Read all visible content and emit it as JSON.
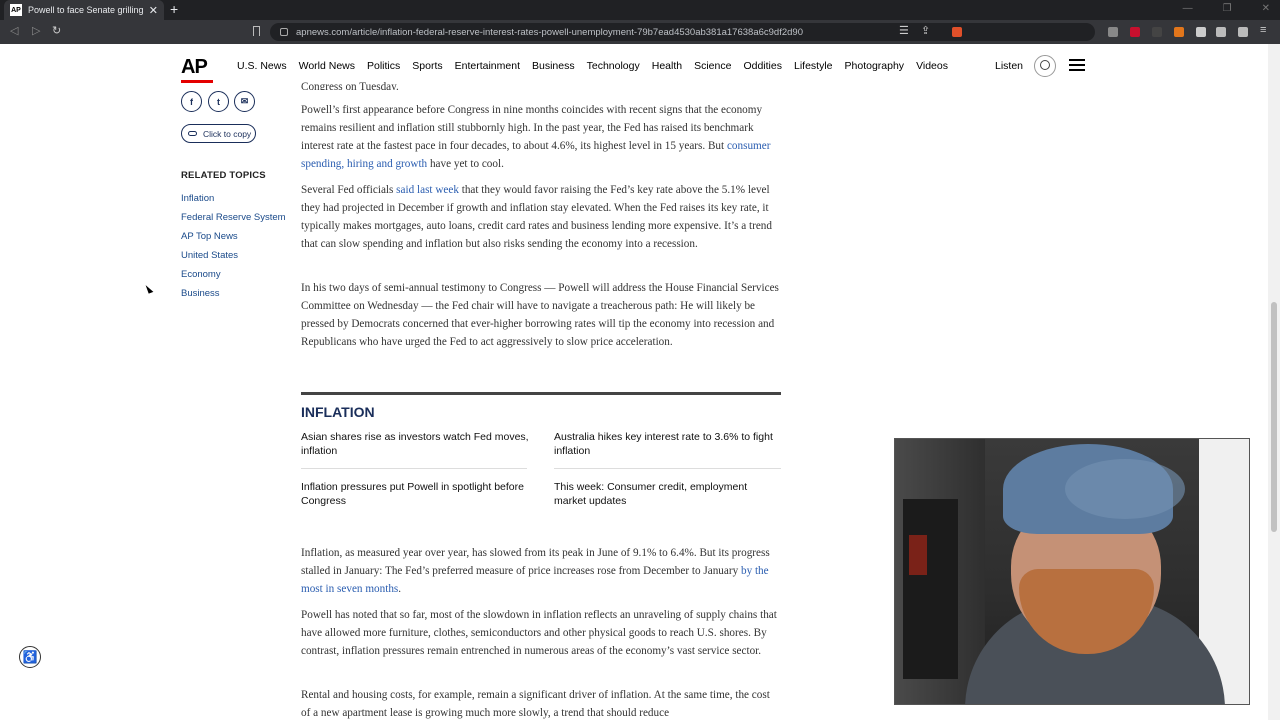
{
  "browser": {
    "tab_favicon": "AP",
    "tab_title": "Powell to face Senate grilling on",
    "url": "apnews.com/article/inflation-federal-reserve-interest-rates-powell-unemployment-79b7ead4530ab381a17638a6c9df2d90"
  },
  "site": {
    "logo": "AP",
    "nav": [
      "U.S. News",
      "World News",
      "Politics",
      "Sports",
      "Entertainment",
      "Business",
      "Technology",
      "Health",
      "Science",
      "Oddities",
      "Lifestyle",
      "Photography",
      "Videos"
    ],
    "listen": "Listen"
  },
  "share": {
    "copy_label": "Click to copy"
  },
  "related": {
    "heading": "RELATED TOPICS",
    "topics": [
      "Inflation",
      "Federal Reserve System",
      "AP Top News",
      "United States",
      "Economy",
      "Business"
    ]
  },
  "article": {
    "cut_line": "Congress on Tuesday.",
    "p1_a": "Powell’s first appearance before Congress in nine months coincides with recent signs that the economy remains resilient and inflation still stubbornly high. In the past year, the Fed has raised its benchmark interest rate at the fastest pace in four decades, to about 4.6%, its highest level in 15 years. But ",
    "p1_link": "consumer spending, hiring and growth",
    "p1_b": " have yet to cool.",
    "p2_a": "Several Fed officials ",
    "p2_link": "said last week",
    "p2_b": " that they would favor raising the Fed’s key rate above the 5.1% level they had projected in December if growth and inflation stay elevated. When the Fed raises its key rate, it typically makes mortgages, auto loans, credit card rates and business lending more expensive. It’s a trend that can slow spending and inflation but also risks sending the economy into a recession.",
    "p3": "In his two days of semi-annual testimony to Congress — Powell will address the House Financial Services Committee on Wednesday — the Fed chair will have to navigate a treacherous path: He will likely be pressed by Democrats concerned that ever-higher borrowing rates will tip the economy into recession and Republicans who have urged the Fed to act aggressively to slow price acceleration.",
    "p4_a": "Inflation, as measured year over year, has slowed from its peak in June of 9.1% to 6.4%. But its progress stalled in January: The Fed’s preferred measure of price increases rose from December to January ",
    "p4_link": "by the most in seven months",
    "p4_b": ".",
    "p5": "Powell has noted that so far, most of the slowdown in inflation reflects an unraveling of supply chains that have allowed more furniture, clothes, semiconductors and other physical goods to reach U.S. shores. By contrast, inflation pressures remain entrenched in numerous areas of the economy’s vast service sector.",
    "p6": "Rental and housing costs, for example, remain a significant driver of inflation. At the same time, the cost of a new apartment lease is growing much more slowly, a trend that should reduce"
  },
  "inflation_box": {
    "title": "INFLATION",
    "items": [
      "Asian shares rise as investors watch Fed moves, inflation",
      "Australia hikes key interest rate to 3.6% to fight inflation",
      "Inflation pressures put Powell in spotlight before Congress",
      "This week: Consumer credit, employment market updates"
    ]
  },
  "icons": {
    "facebook": "facebook-icon",
    "twitter": "twitter-icon",
    "email": "email-icon",
    "accessibility": "accessibility-icon"
  }
}
